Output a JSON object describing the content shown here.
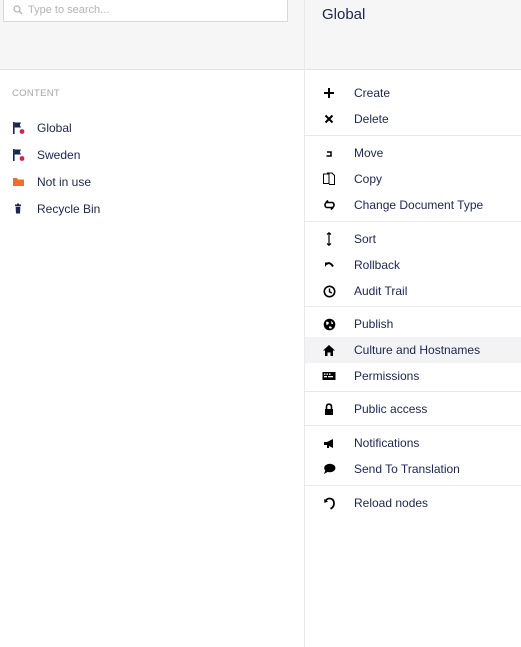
{
  "search": {
    "placeholder": "Type to search..."
  },
  "tree": {
    "section_label": "CONTENT",
    "items": [
      {
        "label": "Global",
        "icon": "flag-icon"
      },
      {
        "label": "Sweden",
        "icon": "flag-icon"
      },
      {
        "label": "Not in use",
        "icon": "folder-icon"
      },
      {
        "label": "Recycle Bin",
        "icon": "trash-icon"
      }
    ]
  },
  "actions_panel": {
    "title": "Global",
    "actions": [
      {
        "label": "Create",
        "icon": "plus-icon"
      },
      {
        "label": "Delete",
        "icon": "close-icon"
      },
      {
        "label": "Move",
        "icon": "move-icon"
      },
      {
        "label": "Copy",
        "icon": "copy-icon"
      },
      {
        "label": "Change Document Type",
        "icon": "exchange-icon"
      },
      {
        "label": "Sort",
        "icon": "sort-icon"
      },
      {
        "label": "Rollback",
        "icon": "undo-icon"
      },
      {
        "label": "Audit Trail",
        "icon": "clock-icon"
      },
      {
        "label": "Publish",
        "icon": "globe-icon"
      },
      {
        "label": "Culture and Hostnames",
        "icon": "home-icon"
      },
      {
        "label": "Permissions",
        "icon": "keyboard-icon"
      },
      {
        "label": "Public access",
        "icon": "lock-icon"
      },
      {
        "label": "Notifications",
        "icon": "megaphone-icon"
      },
      {
        "label": "Send To Translation",
        "icon": "speech-bubble-icon"
      },
      {
        "label": "Reload nodes",
        "icon": "reload-icon"
      }
    ]
  },
  "colors": {
    "text": "#1b264f",
    "folder": "#f26c2b",
    "badge": "#d42054",
    "hover": "#f3f3f5"
  }
}
